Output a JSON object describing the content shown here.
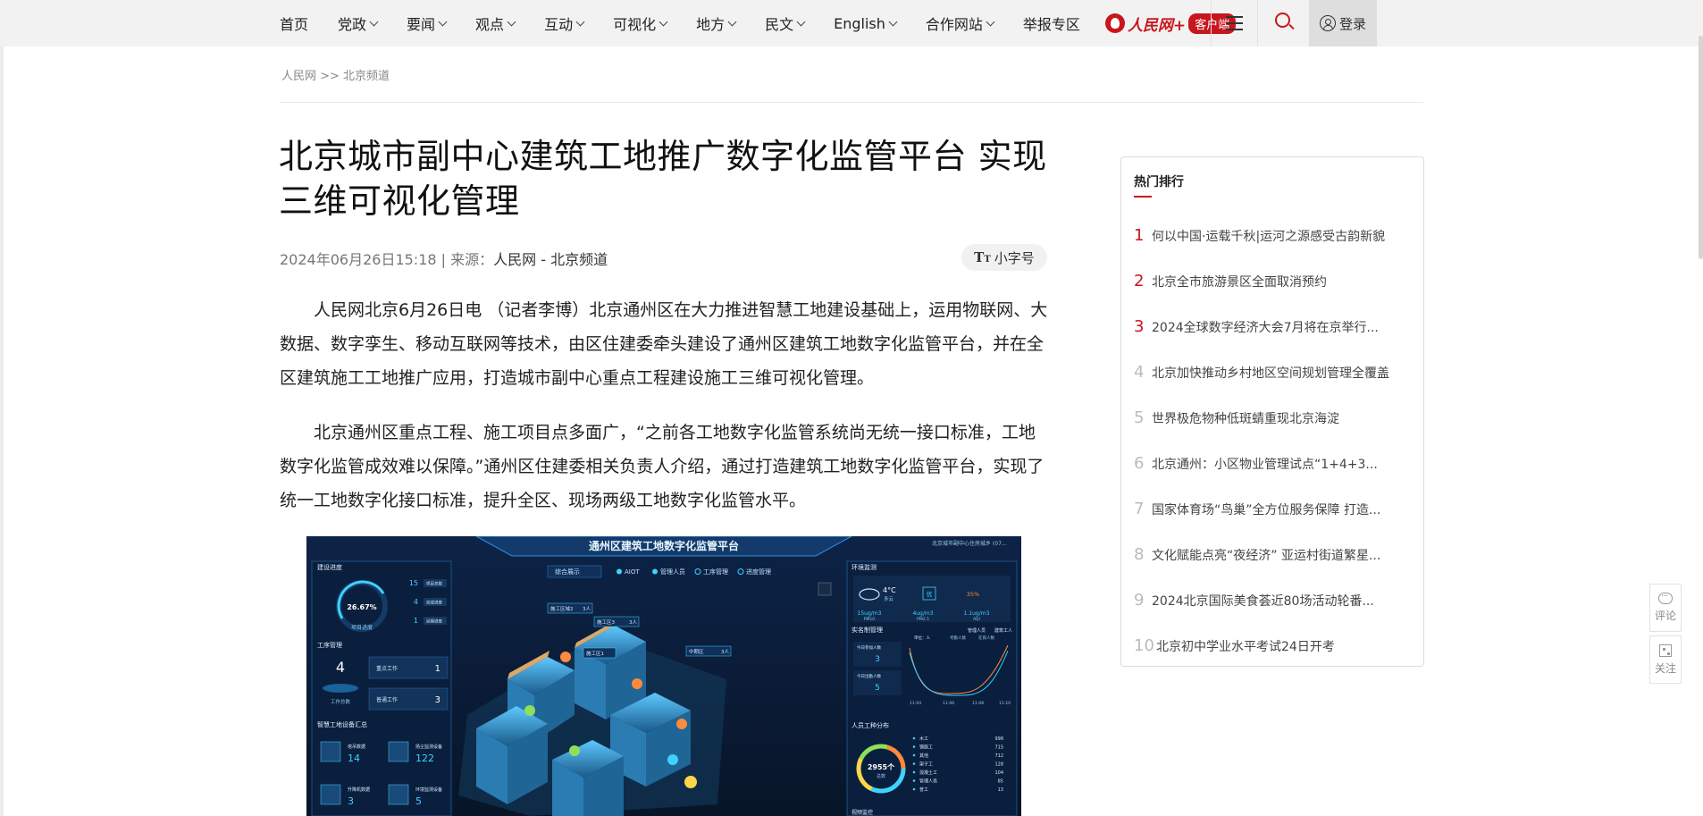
{
  "nav": {
    "items": [
      {
        "label": "首页",
        "has_dropdown": false
      },
      {
        "label": "党政",
        "has_dropdown": true
      },
      {
        "label": "要闻",
        "has_dropdown": true
      },
      {
        "label": "观点",
        "has_dropdown": true
      },
      {
        "label": "互动",
        "has_dropdown": true
      },
      {
        "label": "可视化",
        "has_dropdown": true
      },
      {
        "label": "地方",
        "has_dropdown": true
      },
      {
        "label": "民文",
        "has_dropdown": true
      },
      {
        "label": "English",
        "has_dropdown": true
      },
      {
        "label": "合作网站",
        "has_dropdown": true
      },
      {
        "label": "举报专区",
        "has_dropdown": false
      }
    ],
    "logo_text": "人民网+",
    "logo_badge": "客户端",
    "login_label": "登录"
  },
  "breadcrumb": "人民网 >> 北京频道",
  "article": {
    "title": "北京城市副中心建筑工地推广数字化监管平台 实现三维可视化管理",
    "meta_prefix": "2024年06月26日15:18 | 来源：",
    "source": "人民网 - 北京频道",
    "font_size_label": "小字号",
    "paragraphs": [
      "人民网北京6月26日电 （记者李博）北京通州区在大力推进智慧工地建设基础上，运用物联网、大数据、数字孪生、移动互联网等技术，由区住建委牵头建设了通州区建筑工地数字化监管平台，并在全区建筑施工工地推广应用，打造城市副中心重点工程建设施工三维可视化管理。",
      "北京通州区重点工程、施工项目点多面广，“之前各工地数字化监管系统尚无统一接口标准，工地数字化监管成效难以保障。”通州区住建委相关负责人介绍，通过打造建筑工地数字化监管平台，实现了统一工地数字化接口标准，提升全区、现场两级工地数字化监管水平。"
    ]
  },
  "dashboard": {
    "title": "通州区建筑工地数字化监管平台",
    "corner_text": "北京城市副中心住房城乡 (07...",
    "tabs": [
      "综合展示",
      "AIOT",
      "管理人员",
      "工序管理",
      "进度管理"
    ],
    "left": {
      "progress_title": "建设进度",
      "progress_value": "26.67%",
      "progress_caption": "项目进度",
      "progress_stats": [
        {
          "v": "15",
          "l": "项目总数"
        },
        {
          "v": "4",
          "l": "完成进度"
        },
        {
          "v": "1",
          "l": "延期进度"
        }
      ],
      "process_title": "工序管理",
      "process_total": "4",
      "process_total_caption": "工作总数",
      "process_rows": [
        {
          "l": "重点工作",
          "v": "1"
        },
        {
          "l": "普通工作",
          "v": "3"
        }
      ],
      "device_title": "智慧工地设备汇总",
      "devices": [
        {
          "l": "塔吊数据",
          "v": "14"
        },
        {
          "l": "扬尘监测设备",
          "v": "122"
        },
        {
          "l": "升降机数据",
          "v": "3"
        },
        {
          "l": "环境监测设备",
          "v": "5"
        }
      ]
    },
    "tags": [
      "施工区域2",
      "3人",
      "施工区3",
      "3人",
      "施工区1",
      "中期区",
      "3人"
    ],
    "right": {
      "env_title": "环境监测",
      "temp": "4°C",
      "weather": "多云",
      "aqi_label": "优",
      "humidity": "35%",
      "pm10": "15ug/m3",
      "pm10_l": "PM10",
      "pm25": "4ug/m3",
      "pm25_l": "PM2.5",
      "aqi": "1.1ug/m3",
      "aqi_l": "AQI",
      "attendance_title": "实名制管理",
      "att_legend": [
        "管理人员",
        "建筑工人"
      ],
      "att_unit": "单位：人",
      "att_sub": [
        "今日参加人数",
        "今日出勤人数"
      ],
      "att_values": [
        "3",
        "5"
      ],
      "att_x": [
        "11-04",
        "11-06",
        "11-08",
        "11-10"
      ],
      "att_legend2": [
        "考勤人数",
        "在岗人数"
      ],
      "workers_title": "人员工种分布",
      "workers_total": "2955个",
      "workers_caption": "总数",
      "workers": [
        {
          "l": "木工",
          "v": "998"
        },
        {
          "l": "钢筋工",
          "v": "715"
        },
        {
          "l": "其他",
          "v": "712"
        },
        {
          "l": "架子工",
          "v": "128"
        },
        {
          "l": "混凝土工",
          "v": "104"
        },
        {
          "l": "管理人员",
          "v": "85"
        },
        {
          "l": "普工",
          "v": "13"
        }
      ],
      "video_title": "视频监控"
    }
  },
  "hot": {
    "title": "热门排行",
    "items": [
      {
        "rank": "1",
        "text": "何以中国·运载千秋|运河之源感受古韵新貌"
      },
      {
        "rank": "2",
        "text": "北京全市旅游景区全面取消预约"
      },
      {
        "rank": "3",
        "text": "2024全球数字经济大会7月将在京举行..."
      },
      {
        "rank": "4",
        "text": "北京加快推动乡村地区空间规划管理全覆盖"
      },
      {
        "rank": "5",
        "text": "世界极危物种低斑蜻重现北京海淀"
      },
      {
        "rank": "6",
        "text": "北京通州：小区物业管理试点“1+4+3..."
      },
      {
        "rank": "7",
        "text": "国家体育场“鸟巢”全方位服务保障 打造..."
      },
      {
        "rank": "8",
        "text": "文化赋能点亮“夜经济” 亚运村街道繁星..."
      },
      {
        "rank": "9",
        "text": "2024北京国际美食荟近80场活动轮番..."
      },
      {
        "rank": "10",
        "text": "北京初中学业水平考试24日开考"
      }
    ]
  },
  "float": {
    "comment": "评论",
    "follow": "关注"
  },
  "colors": {
    "brand_red": "#c8161d",
    "topbar_bg": "#f2f2f2",
    "dashboard_bg": "#0b1a33",
    "dashboard_cyan": "#3fd2ff"
  }
}
